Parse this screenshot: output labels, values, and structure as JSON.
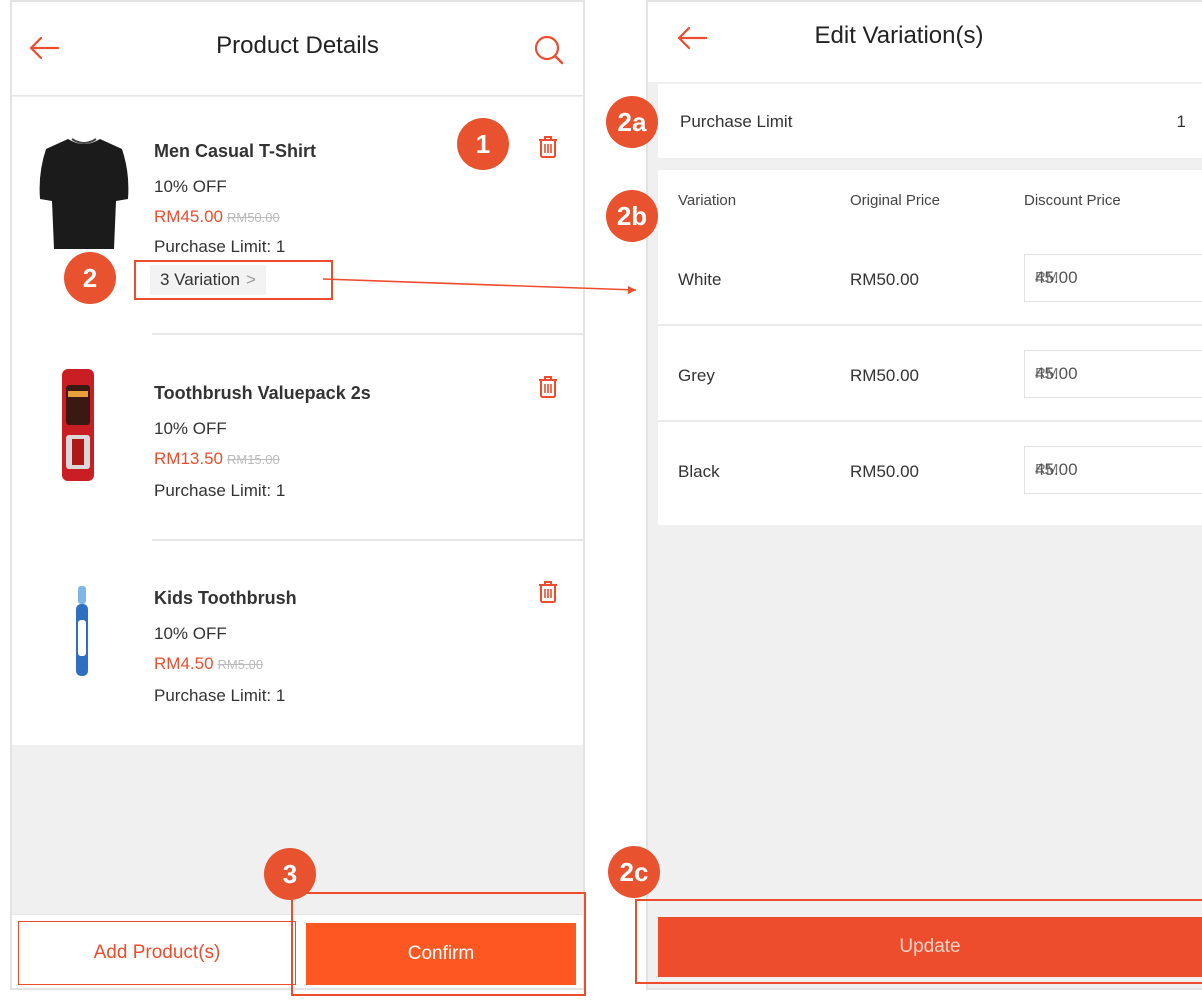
{
  "product_details": {
    "title": "Product Details",
    "products": [
      {
        "name": "Men Casual T-Shirt",
        "discount": "10% OFF",
        "price": "RM45.00",
        "original_price": "RM50.00",
        "limit": "Purchase Limit: 1",
        "variation_label": "3 Variation",
        "thumb": "tshirt-image"
      },
      {
        "name": "Toothbrush Valuepack 2s",
        "discount": "10% OFF",
        "price": "RM13.50",
        "original_price": "RM15.00",
        "limit": "Purchase Limit: 1",
        "thumb": "toothbrush-pack-image"
      },
      {
        "name": "Kids Toothbrush",
        "discount": "10% OFF",
        "price": "RM4.50",
        "original_price": "RM5.00",
        "limit": "Purchase Limit: 1",
        "thumb": "kids-toothbrush-image"
      }
    ],
    "add_button": "Add Product(s)",
    "confirm_button": "Confirm"
  },
  "edit_variation": {
    "title": "Edit Variation(s)",
    "purchase_limit_label": "Purchase Limit",
    "purchase_limit_value": "1",
    "columns": [
      "Variation",
      "Original Price",
      "Discount Price"
    ],
    "rows": [
      {
        "variation": "White",
        "original": "RM50.00",
        "currency": "RM",
        "discount": "45.00"
      },
      {
        "variation": "Grey",
        "original": "RM50.00",
        "currency": "RM",
        "discount": "45.00"
      },
      {
        "variation": "Black",
        "original": "RM50.00",
        "currency": "RM",
        "discount": "45.00"
      }
    ],
    "update_button": "Update"
  },
  "annotations": {
    "b1": "1",
    "b2": "2",
    "b2a": "2a",
    "b2b": "2b",
    "b2c": "2c",
    "b3": "3"
  },
  "colors": {
    "accent": "#ee4d2d",
    "confirm": "#ff5722",
    "badge": "#e8522e"
  },
  "icons": [
    "back-arrow-icon",
    "search-icon",
    "trash-icon",
    "chevron-right-icon"
  ]
}
